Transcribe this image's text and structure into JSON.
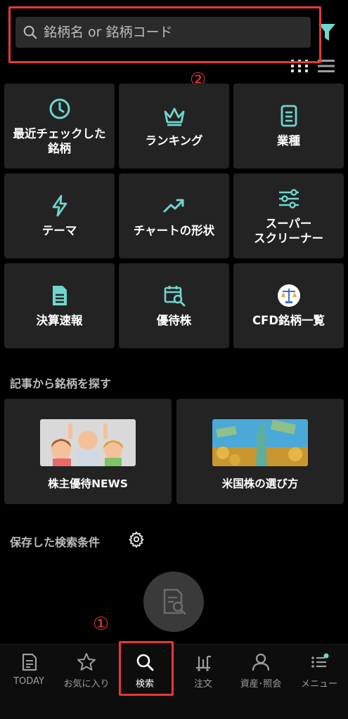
{
  "search": {
    "placeholder": "銘柄名 or 銘柄コード"
  },
  "callouts": {
    "one": "①",
    "two": "②"
  },
  "tiles": [
    {
      "label": "最近チェックした\n銘柄",
      "icon": "clock-icon"
    },
    {
      "label": "ランキング",
      "icon": "crown-icon"
    },
    {
      "label": "業種",
      "icon": "document-icon"
    },
    {
      "label": "テーマ",
      "icon": "lightning-icon"
    },
    {
      "label": "チャートの形状",
      "icon": "trend-up-icon"
    },
    {
      "label": "スーパー\nスクリーナー",
      "icon": "sliders-icon"
    },
    {
      "label": "決算速報",
      "icon": "report-icon"
    },
    {
      "label": "優待株",
      "icon": "calendar-search-icon"
    },
    {
      "label": "CFD銘柄一覧",
      "icon": "scale-icon"
    }
  ],
  "articles_section": {
    "title": "記事から銘柄を探す",
    "items": [
      {
        "label": "株主優待NEWS"
      },
      {
        "label": "米国株の選び方"
      }
    ]
  },
  "saved_section": {
    "title": "保存した検索条件"
  },
  "bottom_nav": [
    {
      "label": "TODAY",
      "icon": "newspaper-icon"
    },
    {
      "label": "お気に入り",
      "icon": "star-icon"
    },
    {
      "label": "検索",
      "icon": "search-icon",
      "active": true
    },
    {
      "label": "注文",
      "icon": "cart-icon"
    },
    {
      "label": "資産･照会",
      "icon": "person-icon"
    },
    {
      "label": "メニュー",
      "icon": "menu-list-icon"
    }
  ],
  "colors": {
    "accent": "#6fd6cf",
    "highlight": "#e53935",
    "tile_bg": "#232323",
    "background": "#000000"
  }
}
